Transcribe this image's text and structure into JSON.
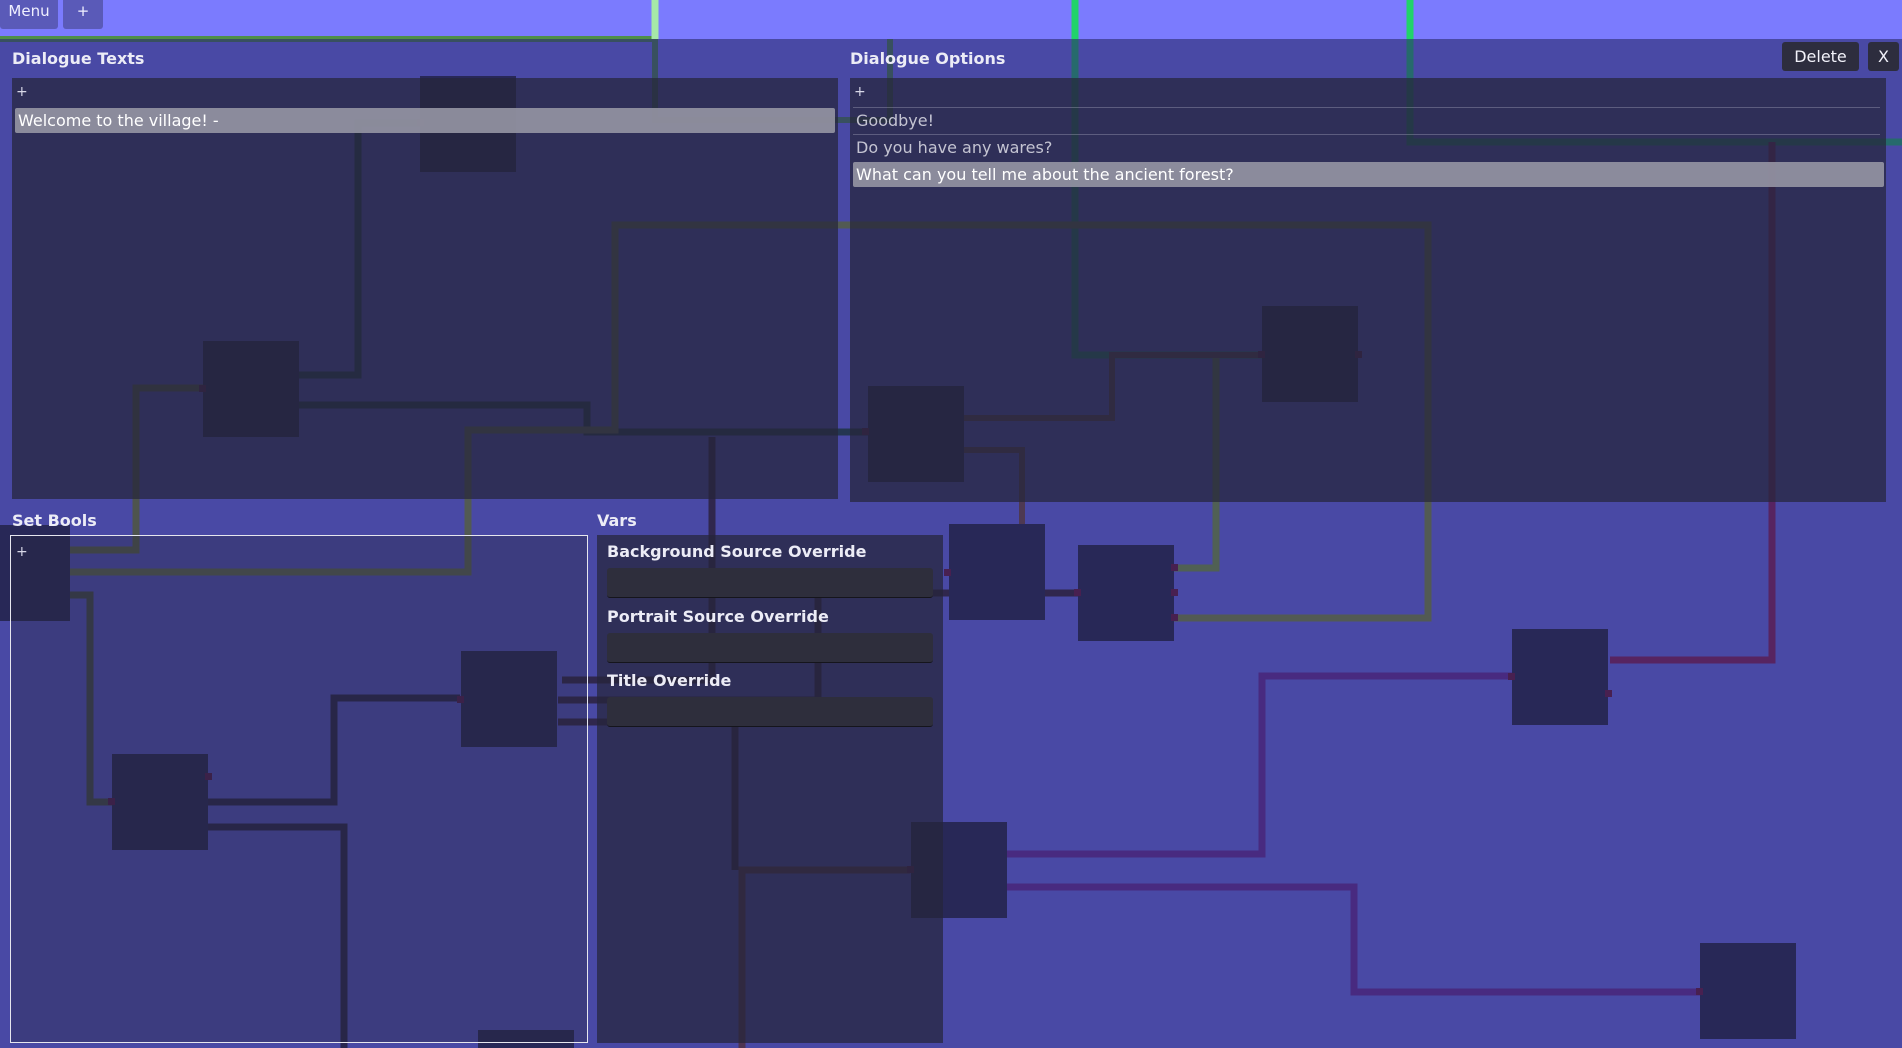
{
  "toolbar": {
    "menu_label": "Menu",
    "add_label": "+"
  },
  "dialog": {
    "delete_label": "Delete",
    "close_label": "X",
    "texts": {
      "title": "Dialogue Texts",
      "add_label": "+",
      "items": [
        {
          "label": "Welcome to the village! -",
          "selected": true
        }
      ]
    },
    "options": {
      "title": "Dialogue Options",
      "add_label": "+",
      "items": [
        {
          "label": "Goodbye!",
          "selected": false
        },
        {
          "label": "Do you have any wares?",
          "selected": false
        },
        {
          "label": "What can you tell me about the ancient forest?",
          "selected": true
        }
      ]
    },
    "bools": {
      "title": "Set Bools",
      "add_label": "+"
    },
    "vars": {
      "title": "Vars",
      "fields": [
        {
          "label": "Background Source Override",
          "value": ""
        },
        {
          "label": "Portrait Source Override",
          "value": ""
        },
        {
          "label": "Title Override",
          "value": ""
        }
      ]
    }
  },
  "colors": {
    "canvas_background": "#7b7bfe",
    "overlay": "#2a2a6e",
    "panel": "#26263a",
    "node": "#262632",
    "port": "#7a1020",
    "selected_row": "#9696a4"
  }
}
